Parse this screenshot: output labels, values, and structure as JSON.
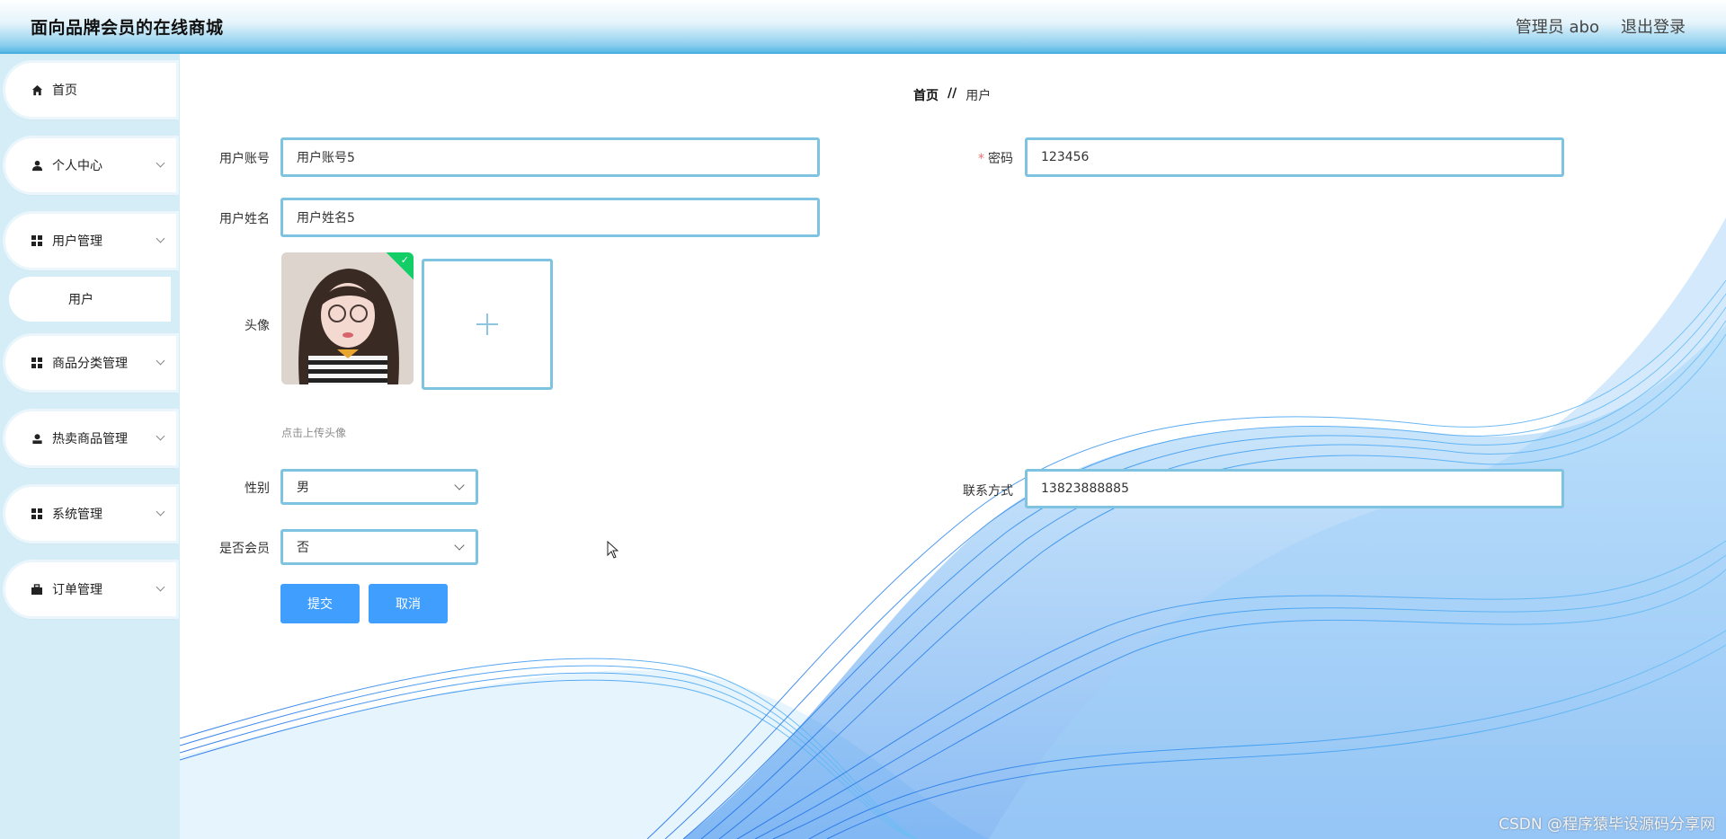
{
  "app": {
    "title": "面向品牌会员的在线商城",
    "admin_label": "管理员 abo",
    "logout_label": "退出登录"
  },
  "sidebar": {
    "items": [
      {
        "label": "首页",
        "icon": "home-icon"
      },
      {
        "label": "个人中心",
        "icon": "person-icon"
      },
      {
        "label": "用户管理",
        "icon": "grid-icon"
      },
      {
        "label": "商品分类管理",
        "icon": "grid-icon"
      },
      {
        "label": "热卖商品管理",
        "icon": "user-icon"
      },
      {
        "label": "系统管理",
        "icon": "grid-icon"
      },
      {
        "label": "订单管理",
        "icon": "briefcase-icon"
      }
    ],
    "sub_item_user": "用户"
  },
  "breadcrumb": {
    "home": "首页",
    "separator": "//",
    "current": "用户"
  },
  "form": {
    "account_label": "用户账号",
    "account_value": "用户账号5",
    "password_label": "密码",
    "password_required_mark": "*",
    "password_value": "123456",
    "name_label": "用户姓名",
    "name_value": "用户姓名5",
    "avatar_label": "头像",
    "upload_hint": "点击上传头像",
    "gender_label": "性别",
    "gender_value": "男",
    "contact_label": "联系方式",
    "contact_value": "13823888885",
    "member_label": "是否会员",
    "member_value": "否"
  },
  "buttons": {
    "submit": "提交",
    "cancel": "取消"
  },
  "watermark": "CSDN @程序猿毕设源码分享网",
  "colors": {
    "primary": "#409eff",
    "input_border": "#7ec3e0",
    "sidebar_bg": "#d5edf7",
    "success": "#13ce66"
  }
}
